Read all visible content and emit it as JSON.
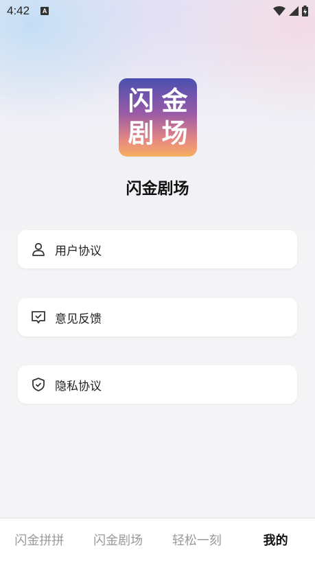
{
  "status_bar": {
    "time": "4:42",
    "notification_letter": "A",
    "icons": [
      "wifi-icon",
      "signal-icon",
      "battery-charging-icon"
    ]
  },
  "app": {
    "logo_chars": [
      "闪",
      "金",
      "剧",
      "场"
    ],
    "title": "闪金剧场"
  },
  "menu": {
    "items": [
      {
        "label": "用户协议",
        "icon": "person-icon"
      },
      {
        "label": "意见反馈",
        "icon": "feedback-icon"
      },
      {
        "label": "隐私协议",
        "icon": "shield-check-icon"
      }
    ]
  },
  "tabbar": {
    "tabs": [
      {
        "label": "闪金拼拼",
        "active": false
      },
      {
        "label": "闪金剧场",
        "active": false
      },
      {
        "label": "轻松一刻",
        "active": false
      },
      {
        "label": "我的",
        "active": true
      }
    ]
  },
  "colors": {
    "active_tab": "#111111",
    "inactive_tab": "#999999",
    "logo_gradient_top": "#4a4fb0",
    "logo_gradient_bottom": "#f5b060"
  }
}
